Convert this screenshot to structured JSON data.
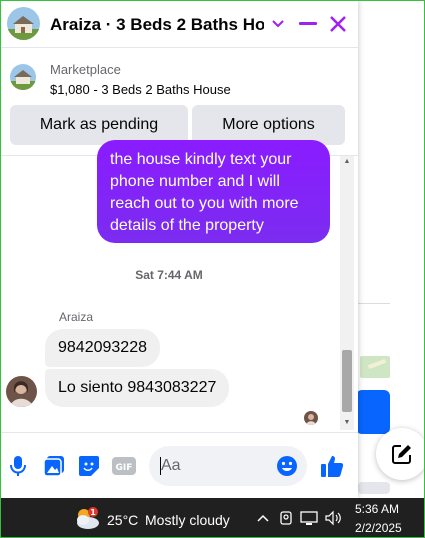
{
  "colors": {
    "accent": "#a020f0",
    "bubble_out": "#8a1cff",
    "bubble_in": "#f0f0f0",
    "messenger_blue": "#0866ff",
    "taskbar": "#202020"
  },
  "header": {
    "title": "Araiza · 3 Beds 2 Baths Ho...",
    "icons": [
      "avatar",
      "chevron-down-icon",
      "minimize-icon",
      "close-icon"
    ]
  },
  "marketplace": {
    "label": "Marketplace",
    "listing": "$1,080 - 3 Beds 2 Baths House"
  },
  "actions": {
    "mark_pending": "Mark as pending",
    "more_options": "More options"
  },
  "messages": {
    "outgoing_text": "the house kindly text your phone number and I will reach out to you with more details of the property",
    "timestamp": "Sat 7:44 AM",
    "sender_name": "Araiza",
    "incoming": [
      "9842093228",
      "Lo siento 9843083227"
    ]
  },
  "composer": {
    "placeholder": "Aa",
    "icons": [
      "microphone-icon",
      "photo-icon",
      "sticker-icon",
      "gif-icon",
      "emoji-icon",
      "thumbs-up-icon"
    ],
    "gif_label": "GIF"
  },
  "taskbar": {
    "weather_badge": "1",
    "temperature": "25°C",
    "condition": "Mostly cloudy",
    "time": "5:36 AM",
    "date": "2/2/2025",
    "tray_icons": [
      "chevron-up-icon",
      "camera-icon",
      "network-icon",
      "volume-icon"
    ]
  }
}
